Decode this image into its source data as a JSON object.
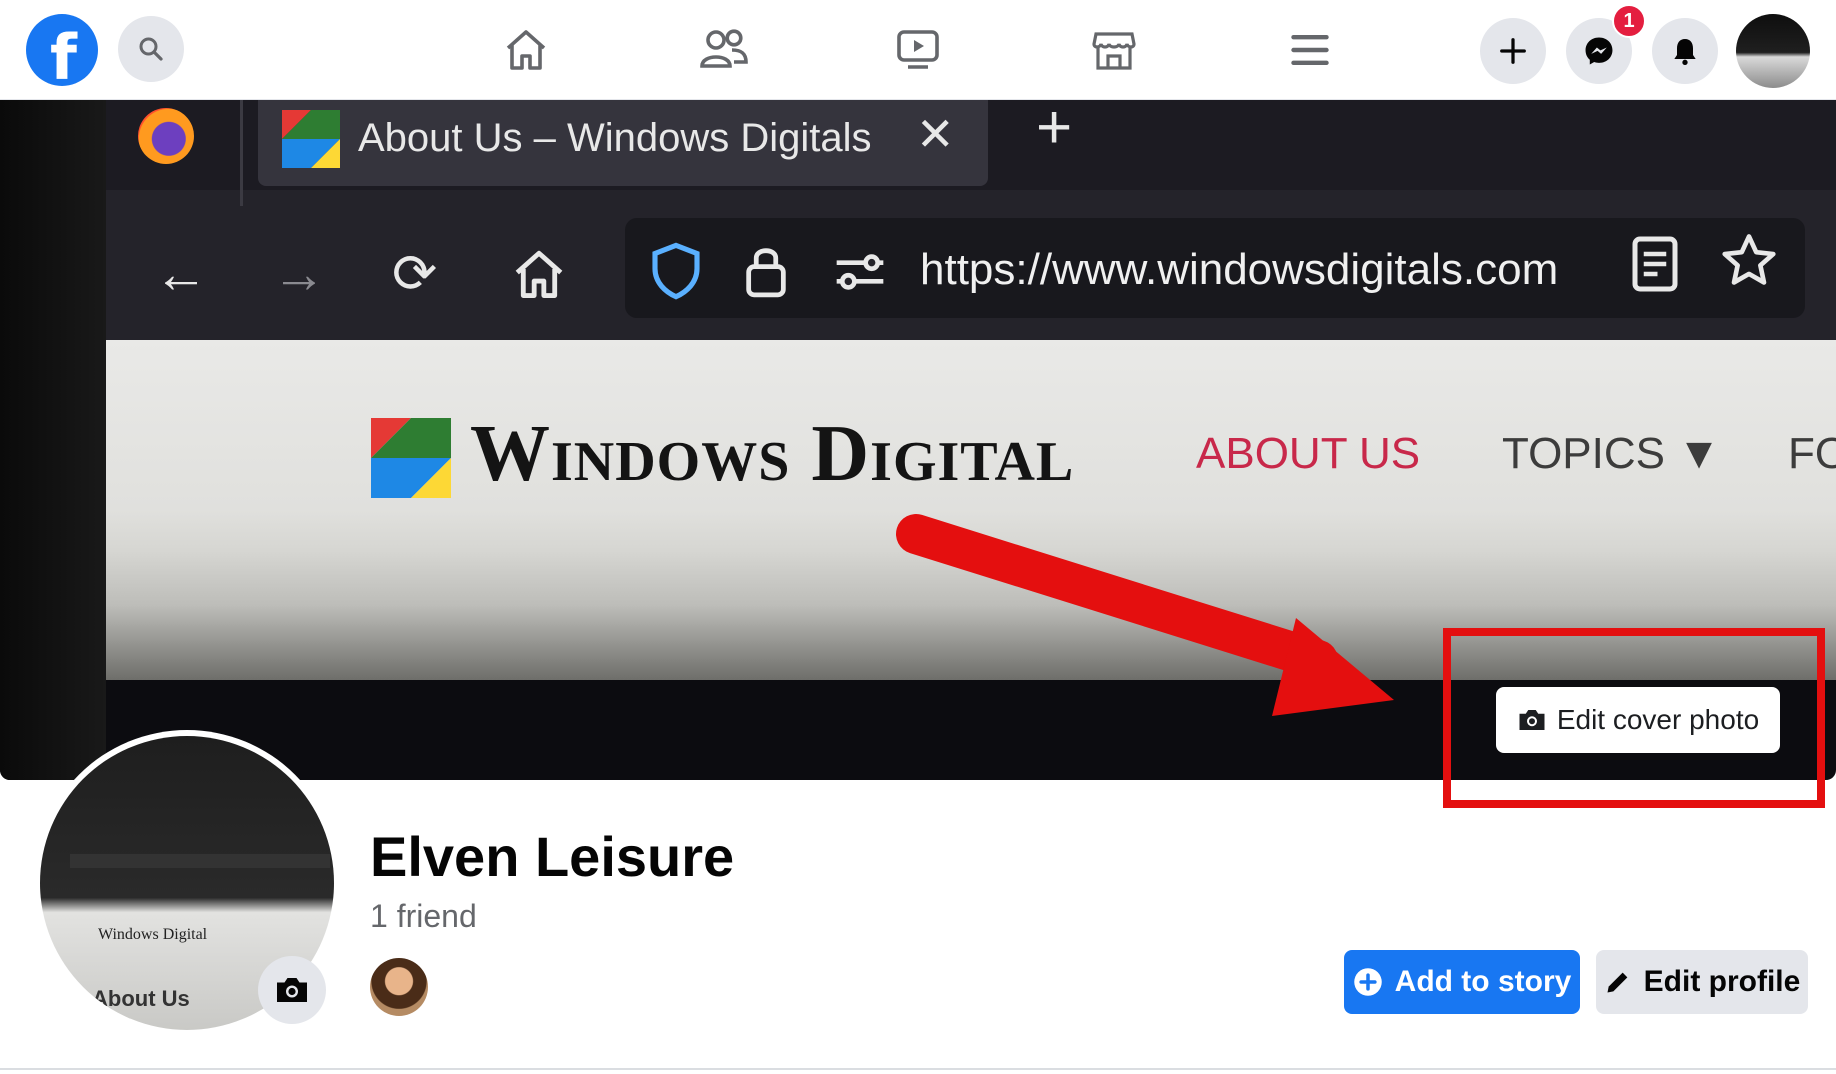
{
  "app": {
    "name": "Facebook"
  },
  "topbar": {
    "notification_count": "1",
    "icons": [
      "facebook-logo",
      "search-icon",
      "home-icon",
      "friends-icon",
      "watch-icon",
      "marketplace-icon",
      "menu-icon",
      "create-icon",
      "messenger-icon",
      "notifications-icon",
      "account-avatar"
    ]
  },
  "cover_photo": {
    "browser_tab_title": "About Us – Windows Digitals",
    "url": "https://www.windowsdigitals.com",
    "site_name": "Windows Digital",
    "site_nav": {
      "about": "ABOUT US",
      "topics": "TOPICS ▼",
      "partial": "FO"
    },
    "edit_button_label": "Edit cover photo"
  },
  "profile_picture": {
    "site_name": "Windows Digital",
    "caption": "About Us"
  },
  "profile": {
    "name": "Elven Leisure",
    "friends": "1 friend"
  },
  "actions": {
    "add_to_story": "Add to story",
    "edit_profile": "Edit profile"
  },
  "colors": {
    "facebook_blue": "#1877f2",
    "annotation_red": "#e40f0f",
    "site_accent": "#c8284a"
  }
}
